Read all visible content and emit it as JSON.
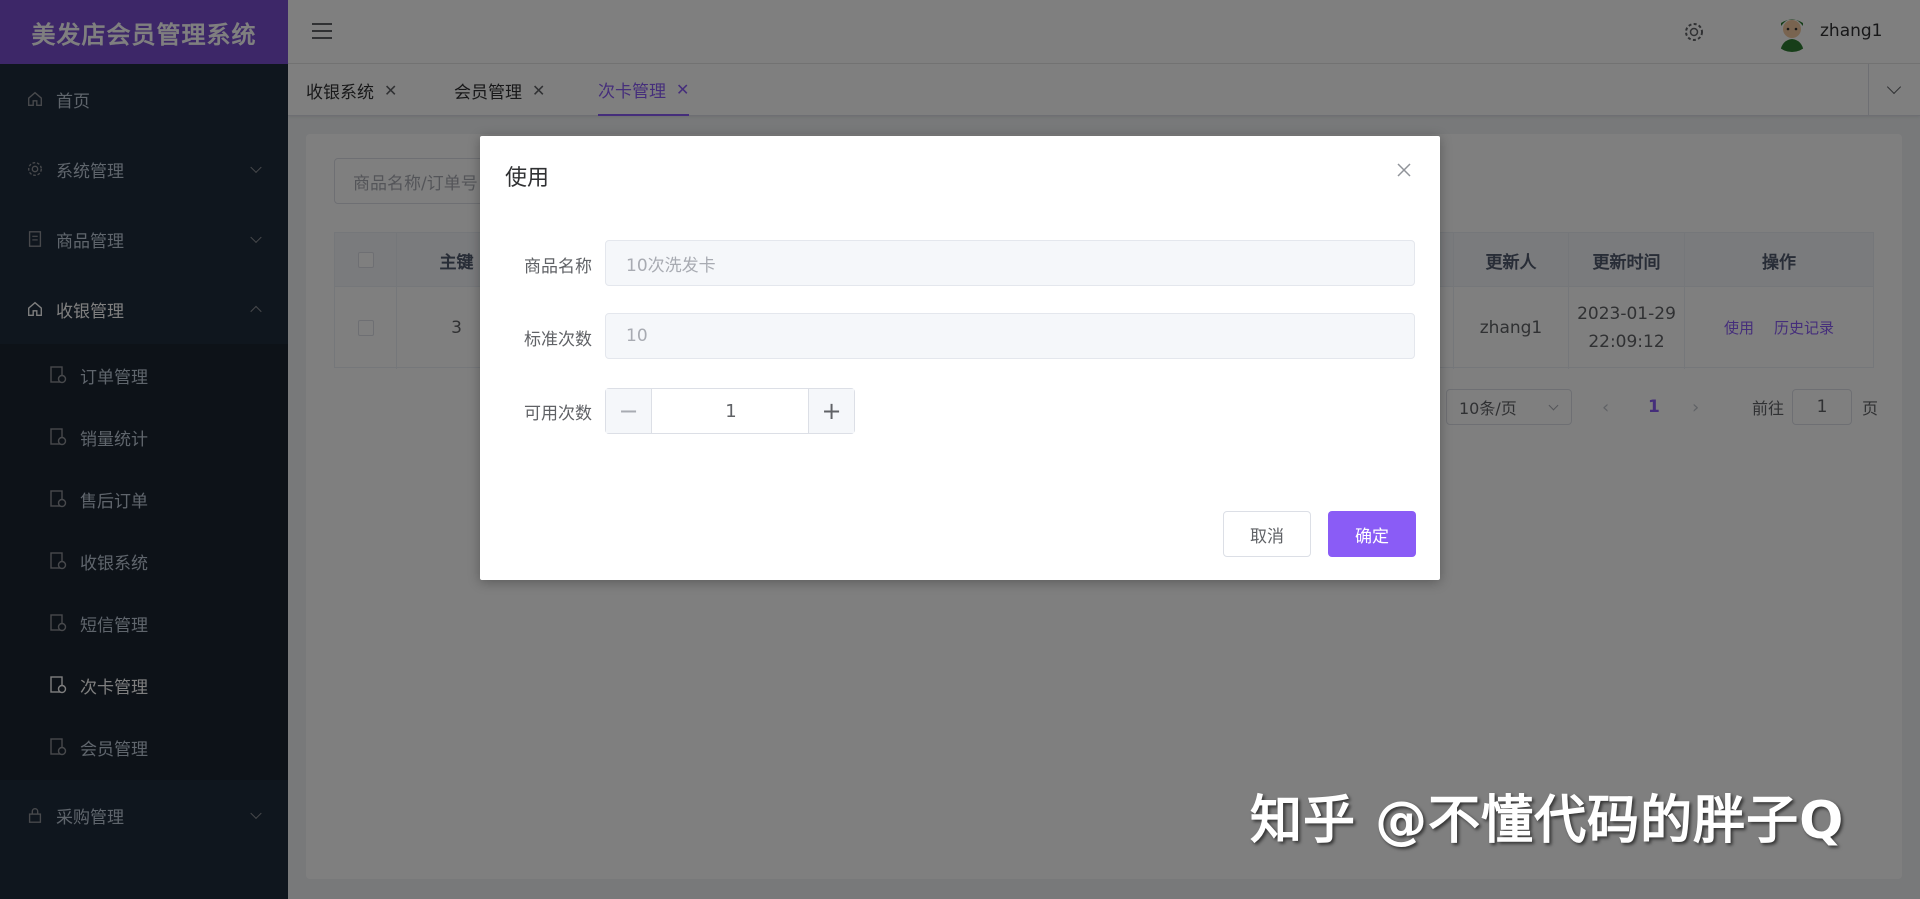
{
  "app": {
    "title": "美发店会员管理系统"
  },
  "sidebar": {
    "items": [
      {
        "label": "首页",
        "icon": "home-icon"
      },
      {
        "label": "系统管理",
        "icon": "gear-icon"
      },
      {
        "label": "商品管理",
        "icon": "document-icon"
      },
      {
        "label": "收银管理",
        "icon": "home-icon"
      }
    ],
    "subitems": [
      {
        "label": "订单管理"
      },
      {
        "label": "销量统计"
      },
      {
        "label": "售后订单"
      },
      {
        "label": "收银系统"
      },
      {
        "label": "短信管理"
      },
      {
        "label": "次卡管理"
      },
      {
        "label": "会员管理"
      }
    ],
    "last_item": {
      "label": "采购管理",
      "icon": "lock-icon"
    }
  },
  "header": {
    "username": "zhang1"
  },
  "tabs": [
    {
      "label": "收银系统"
    },
    {
      "label": "会员管理"
    },
    {
      "label": "次卡管理"
    }
  ],
  "main": {
    "search": {
      "placeholder": "商品名称/订单号"
    },
    "table": {
      "headers": [
        "主键",
        "更新人",
        "更新时间",
        "操作"
      ],
      "row": {
        "id": "3",
        "updater": "zhang1",
        "update_date": "2023-01-29",
        "update_time": "22:09:12",
        "actions": [
          "使用",
          "历史记录"
        ]
      }
    },
    "pagination": {
      "page_size": "10条/页",
      "current_page": "1",
      "goto_label": "前往",
      "goto_value": "1",
      "page_suffix": "页"
    }
  },
  "dialog": {
    "title": "使用",
    "fields": {
      "product_name_label": "商品名称",
      "product_name_value": "10次洗发卡",
      "standard_count_label": "标准次数",
      "standard_count_value": "10",
      "available_count_label": "可用次数",
      "available_count_value": "1"
    },
    "cancel_label": "取消",
    "ok_label": "确定"
  },
  "watermark": "知乎 @不懂代码的胖子Q",
  "colors": {
    "accent": "#8a5cf6",
    "sidebar": "#1f2d3d",
    "logo": "#7b4fd1"
  }
}
